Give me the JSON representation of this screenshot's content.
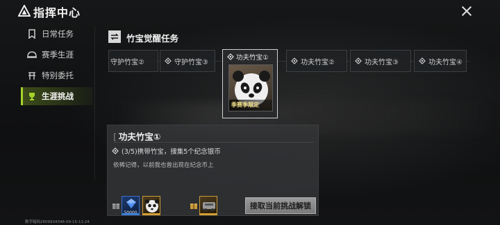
{
  "header": {
    "title": "指挥中心",
    "close_icon": "close-icon"
  },
  "sidebar": {
    "items": [
      {
        "label": "日常任务",
        "icon": "bookmark-icon",
        "active": false
      },
      {
        "label": "赛季生涯",
        "icon": "helmet-icon",
        "active": false
      },
      {
        "label": "特别委托",
        "icon": "ledger-icon",
        "active": false
      },
      {
        "label": "生涯挑战",
        "icon": "trophy-icon",
        "active": true
      }
    ]
  },
  "section": {
    "title": "竹宝觉醒任务",
    "icon": "swap-arrows-icon"
  },
  "stages": [
    {
      "label": "守护竹宝②"
    },
    {
      "label": "守护竹宝③"
    },
    {
      "label": "功夫竹宝①",
      "selected": true,
      "card_label": "季赛季限定"
    },
    {
      "label": "功夫竹宝②"
    },
    {
      "label": "功夫竹宝③"
    },
    {
      "label": "功夫竹宝④"
    }
  ],
  "detail": {
    "title": "功夫竹宝①",
    "task": "(3/5)携带竹宝，搜集5个纪念银币",
    "description": "依稀记得，以前我也曾出现在纪念币上",
    "rewards_left": [
      {
        "icon": "blue-crate-icon",
        "count": "50000"
      },
      {
        "icon": "panda-icon",
        "count": ""
      }
    ],
    "rewards_right": [
      {
        "icon": "vehicle-skin-icon",
        "count": ""
      }
    ],
    "action_label": "接取当前挑战解锁"
  },
  "footer": {
    "id_text": "数字暗码2609934346-09-15-11:24"
  },
  "colors": {
    "accent": "#a6d42a",
    "panel": "#343638",
    "card_border": "#cfd3d6"
  }
}
